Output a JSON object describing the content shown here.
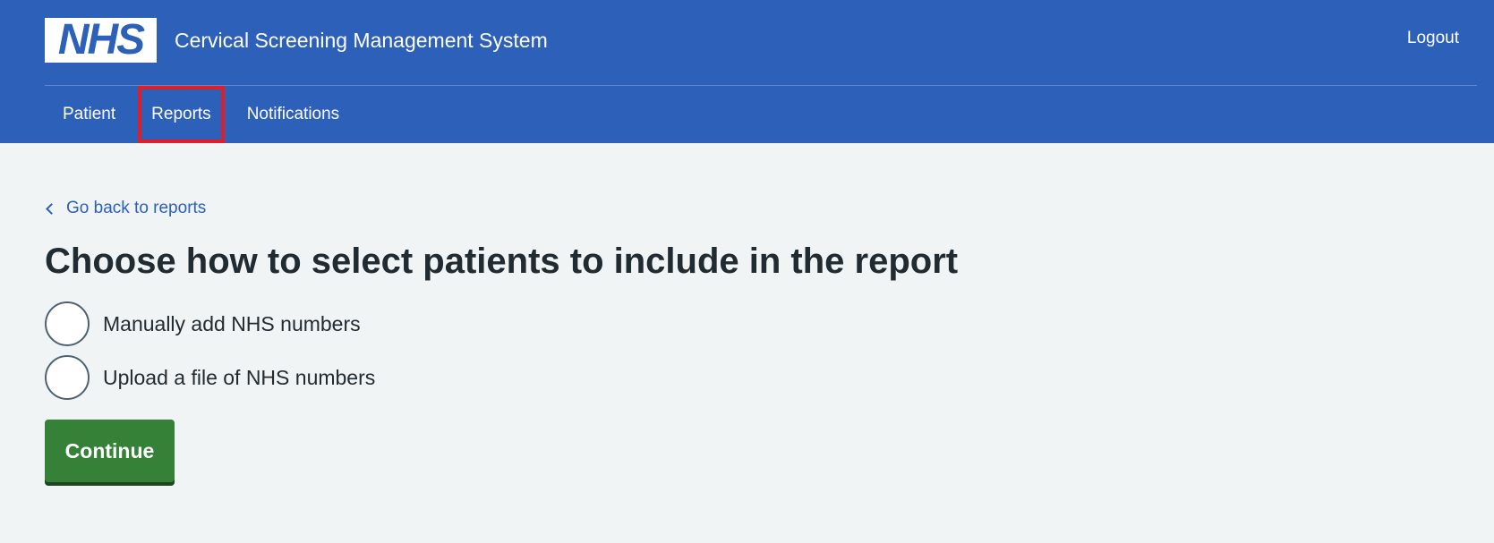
{
  "header": {
    "logo_text": "NHS",
    "service_name": "Cervical Screening Management System",
    "logout_label": "Logout",
    "brand_color": "#2c60b9"
  },
  "nav": {
    "items": [
      {
        "label": "Patient"
      },
      {
        "label": "Reports",
        "highlighted": true
      },
      {
        "label": "Notifications"
      }
    ],
    "highlight_color": "#e01e27"
  },
  "main": {
    "back_link": "Go back to reports",
    "title": "Choose how to select patients to include in the report",
    "options": [
      {
        "label": "Manually add NHS numbers",
        "selected": false
      },
      {
        "label": "Upload a file of NHS numbers",
        "selected": false
      }
    ],
    "continue_label": "Continue",
    "button_color": "#358138"
  }
}
